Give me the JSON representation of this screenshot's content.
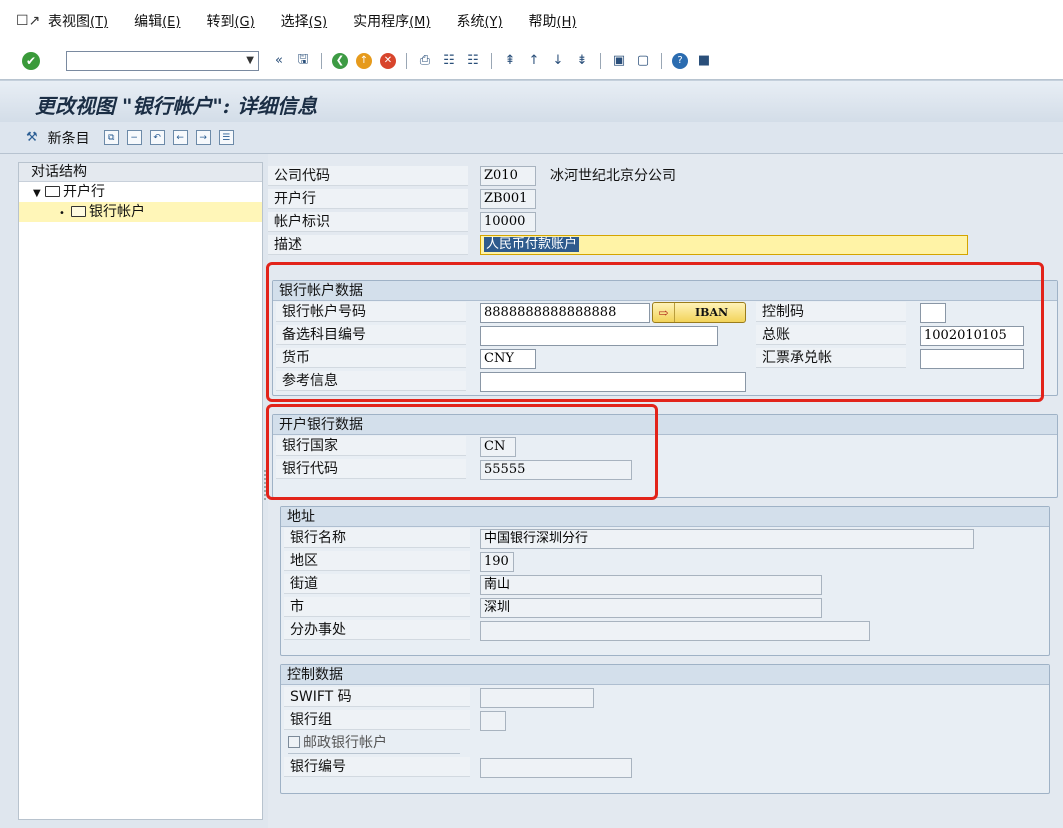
{
  "menu": {
    "items": [
      {
        "label": "表视图",
        "acc": "(T)"
      },
      {
        "label": "编辑",
        "acc": "(E)"
      },
      {
        "label": "转到",
        "acc": "(G)"
      },
      {
        "label": "选择",
        "acc": "(S)"
      },
      {
        "label": "实用程序",
        "acc": "(M)"
      },
      {
        "label": "系统",
        "acc": "(Y)"
      },
      {
        "label": "帮助",
        "acc": "(H)"
      }
    ]
  },
  "toolbar": {
    "command_value": "",
    "icons": [
      "check-icon",
      "save-icon",
      "back-icon",
      "exit-icon",
      "cancel-icon",
      "print-icon",
      "find-icon",
      "find-next-icon",
      "first-page-icon",
      "prev-page-icon",
      "next-page-icon",
      "last-page-icon",
      "new-session-icon",
      "shortcut-icon",
      "help-icon",
      "customize-layout-icon"
    ]
  },
  "title": "更改视图 \"银行帐户\": 详细信息",
  "app_toolbar": {
    "new_entries_label": "新条目"
  },
  "nav": {
    "header": "对话结构",
    "node1": "开户行",
    "node2": "银行帐户"
  },
  "header_fields": {
    "company_code_label": "公司代码",
    "company_code_value": "Z010",
    "company_name": "冰河世纪北京分公司",
    "house_bank_label": "开户行",
    "house_bank_value": "ZB001",
    "account_id_label": "帐户标识",
    "account_id_value": "10000",
    "description_label": "描述",
    "description_value": "人民币付款账户"
  },
  "bank_account_data": {
    "title": "银行帐户数据",
    "account_number_label": "银行帐户号码",
    "account_number_value": "8888888888888888",
    "iban_label": "IBAN",
    "control_key_label": "控制码",
    "control_key_value": "",
    "alt_account_label": "备选科目编号",
    "alt_account_value": "",
    "gl_label": "总账",
    "gl_value": "1002010105",
    "currency_label": "货币",
    "currency_value": "CNY",
    "bill_label": "汇票承兑帐",
    "bill_value": "",
    "ref_label": "参考信息",
    "ref_value": ""
  },
  "house_bank_data": {
    "title": "开户银行数据",
    "country_label": "银行国家",
    "country_value": "CN",
    "bank_key_label": "银行代码",
    "bank_key_value": "55555"
  },
  "address": {
    "title": "地址",
    "bank_name_label": "银行名称",
    "bank_name_value": "中国银行深圳分行",
    "region_label": "地区",
    "region_value": "190",
    "street_label": "街道",
    "street_value": "南山",
    "city_label": "市",
    "city_value": "深圳",
    "branch_label": "分办事处",
    "branch_value": ""
  },
  "control_data": {
    "title": "控制数据",
    "swift_label": "SWIFT 码",
    "swift_value": "",
    "bank_group_label": "银行组",
    "bank_group_value": "",
    "postal_label": "邮政银行帐户",
    "bank_number_label": "银行编号",
    "bank_number_value": ""
  },
  "colors": {
    "highlight_box": "#e2231a",
    "title_text": "#1b2e45",
    "selected_node": "#fff6b8"
  }
}
